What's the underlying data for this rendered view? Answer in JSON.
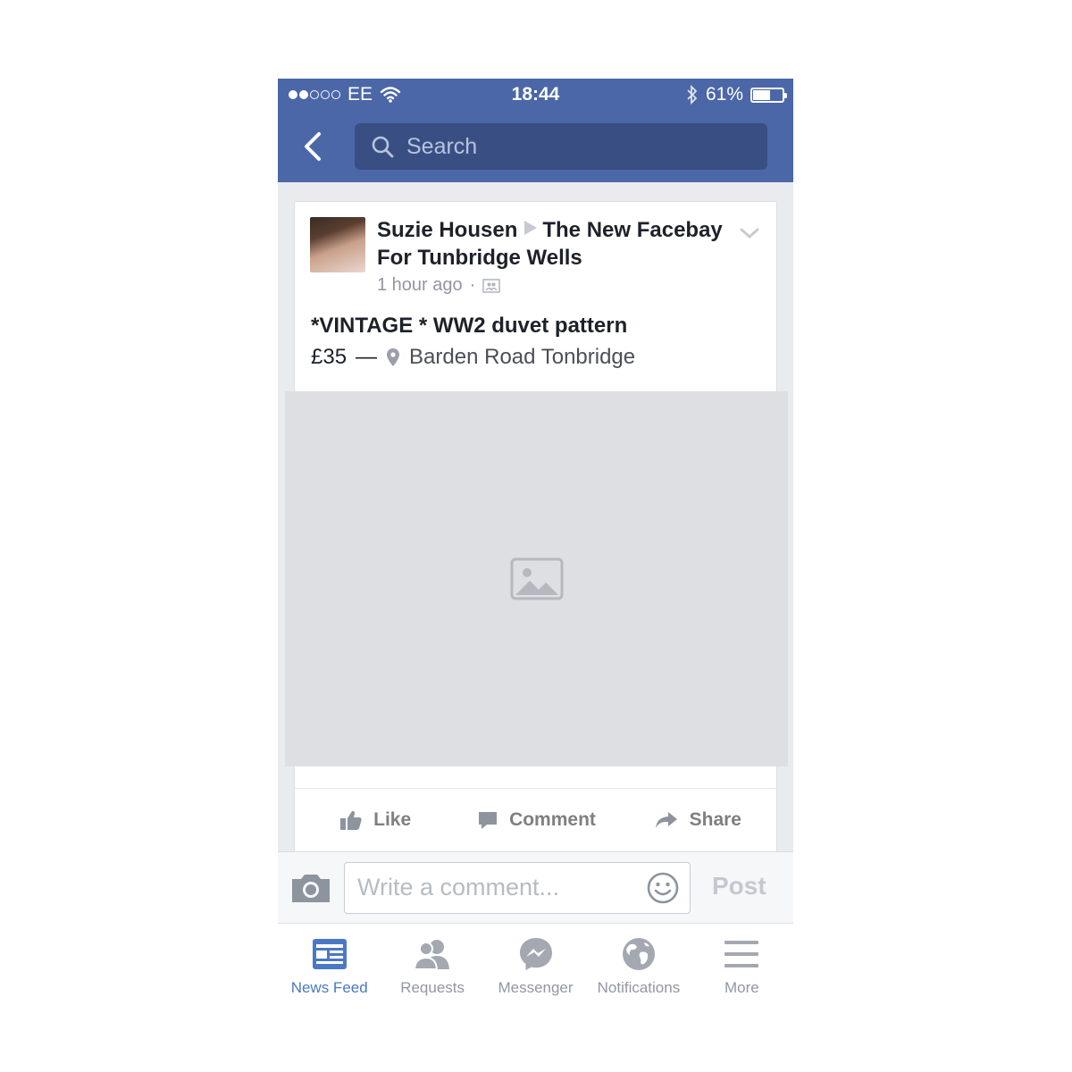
{
  "status_bar": {
    "carrier": "EE",
    "time": "18:44",
    "battery": "61%",
    "battery_level": 0.61
  },
  "nav": {
    "search_placeholder": "Search"
  },
  "post": {
    "author": "Suzie Housen",
    "group": "The New Facebay For Tunbridge Wells",
    "time": "1 hour ago",
    "separator": "·",
    "title": "*VINTAGE * WW2 duvet pattern",
    "price": "£35",
    "dash": "—",
    "location": "Barden Road Tonbridge"
  },
  "actions": {
    "like": "Like",
    "comment": "Comment",
    "share": "Share"
  },
  "comment_bar": {
    "placeholder": "Write a comment...",
    "post_label": "Post"
  },
  "tabs": [
    {
      "label": "News Feed",
      "icon": "news-feed-icon",
      "active": true
    },
    {
      "label": "Requests",
      "icon": "requests-icon",
      "active": false
    },
    {
      "label": "Messenger",
      "icon": "messenger-icon",
      "active": false
    },
    {
      "label": "Notifications",
      "icon": "globe-icon",
      "active": false
    },
    {
      "label": "More",
      "icon": "menu-icon",
      "active": false
    }
  ],
  "colors": {
    "brand_blue": "#4b67a7",
    "active_tab": "#4b78c6"
  }
}
